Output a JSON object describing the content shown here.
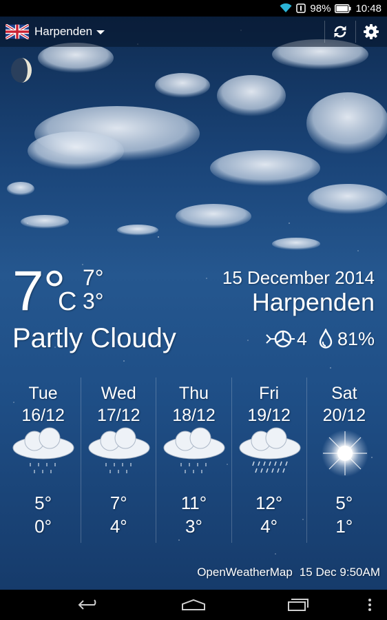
{
  "status_bar": {
    "battery": "98%",
    "time": "10:48",
    "icons": [
      "wifi-icon",
      "notification-icon",
      "battery-icon"
    ]
  },
  "action_bar": {
    "location": "Harpenden",
    "icons": [
      "uk-flag-icon",
      "refresh-icon",
      "settings-icon"
    ]
  },
  "current": {
    "temp": "7°",
    "unit": "C",
    "high": "7°",
    "low": "3°",
    "condition": "Partly Cloudy",
    "date": "15 December 2014",
    "city": "Harpenden",
    "wind_speed": "4",
    "humidity": "81%"
  },
  "forecast": [
    {
      "day": "Tue",
      "date": "16/12",
      "high": "5°",
      "low": "0°",
      "icon": "light-rain-cloud-icon"
    },
    {
      "day": "Wed",
      "date": "17/12",
      "high": "7°",
      "low": "4°",
      "icon": "light-rain-cloud-icon"
    },
    {
      "day": "Thu",
      "date": "18/12",
      "high": "11°",
      "low": "3°",
      "icon": "light-rain-cloud-icon"
    },
    {
      "day": "Fri",
      "date": "19/12",
      "high": "12°",
      "low": "4°",
      "icon": "rain-cloud-icon"
    },
    {
      "day": "Sat",
      "date": "20/12",
      "high": "5°",
      "low": "1°",
      "icon": "sun-icon"
    }
  ],
  "footer": {
    "provider": "OpenWeatherMap",
    "updated": "15 Dec 9:50AM"
  },
  "colors": {
    "sky_top": "#0f2c52",
    "sky_mid": "#25578f",
    "sky_bottom": "#163b6b",
    "text": "#ffffff"
  }
}
